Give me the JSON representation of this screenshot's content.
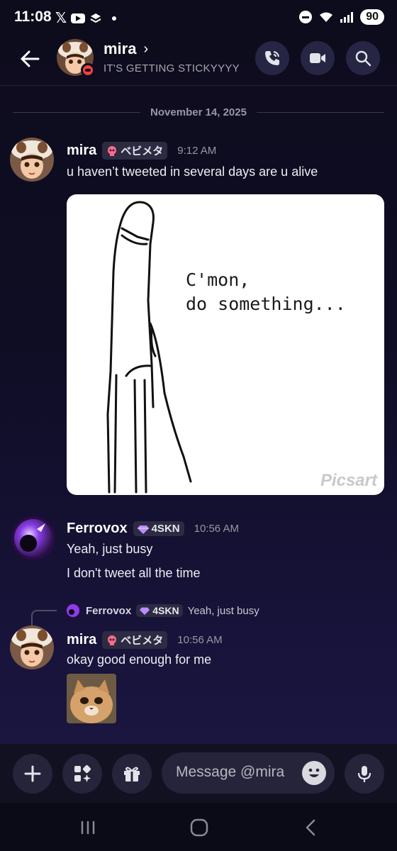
{
  "status_bar": {
    "time": "11:08",
    "battery": "90",
    "app_icons": [
      "x-icon",
      "youtube-icon",
      "stack-icon"
    ]
  },
  "header": {
    "name": "mira",
    "chevron": "›",
    "status_text": "IT'S GETTING STICKYYYY",
    "buttons": [
      "call-icon",
      "video-icon",
      "search-icon"
    ]
  },
  "date_divider": "November 14, 2025",
  "messages": [
    {
      "author": "mira",
      "tag": "ベビメタ",
      "time": "9:12 AM",
      "lines": [
        "u haven’t tweeted in several days are u alive"
      ],
      "attachment": {
        "meme_caption_line1": "C'mon,",
        "meme_caption_line2": "do something...",
        "watermark": "Picsart"
      }
    },
    {
      "author": "Ferrovox",
      "tag": "4SKN",
      "time": "10:56 AM",
      "lines": [
        "Yeah, just busy",
        "I don't tweet all the time"
      ]
    },
    {
      "reply": {
        "author": "Ferrovox",
        "tag": "4SKN",
        "text": "Yeah, just busy"
      },
      "author": "mira",
      "tag": "ベビメタ",
      "time": "10:56 AM",
      "lines": [
        "okay good enough for me"
      ]
    }
  ],
  "input": {
    "placeholder": "Message @mira"
  },
  "colors": {
    "accent_dnd": "#f23f43",
    "tag_purple": "#b98cff",
    "tag_pink": "#ff6b8a"
  }
}
